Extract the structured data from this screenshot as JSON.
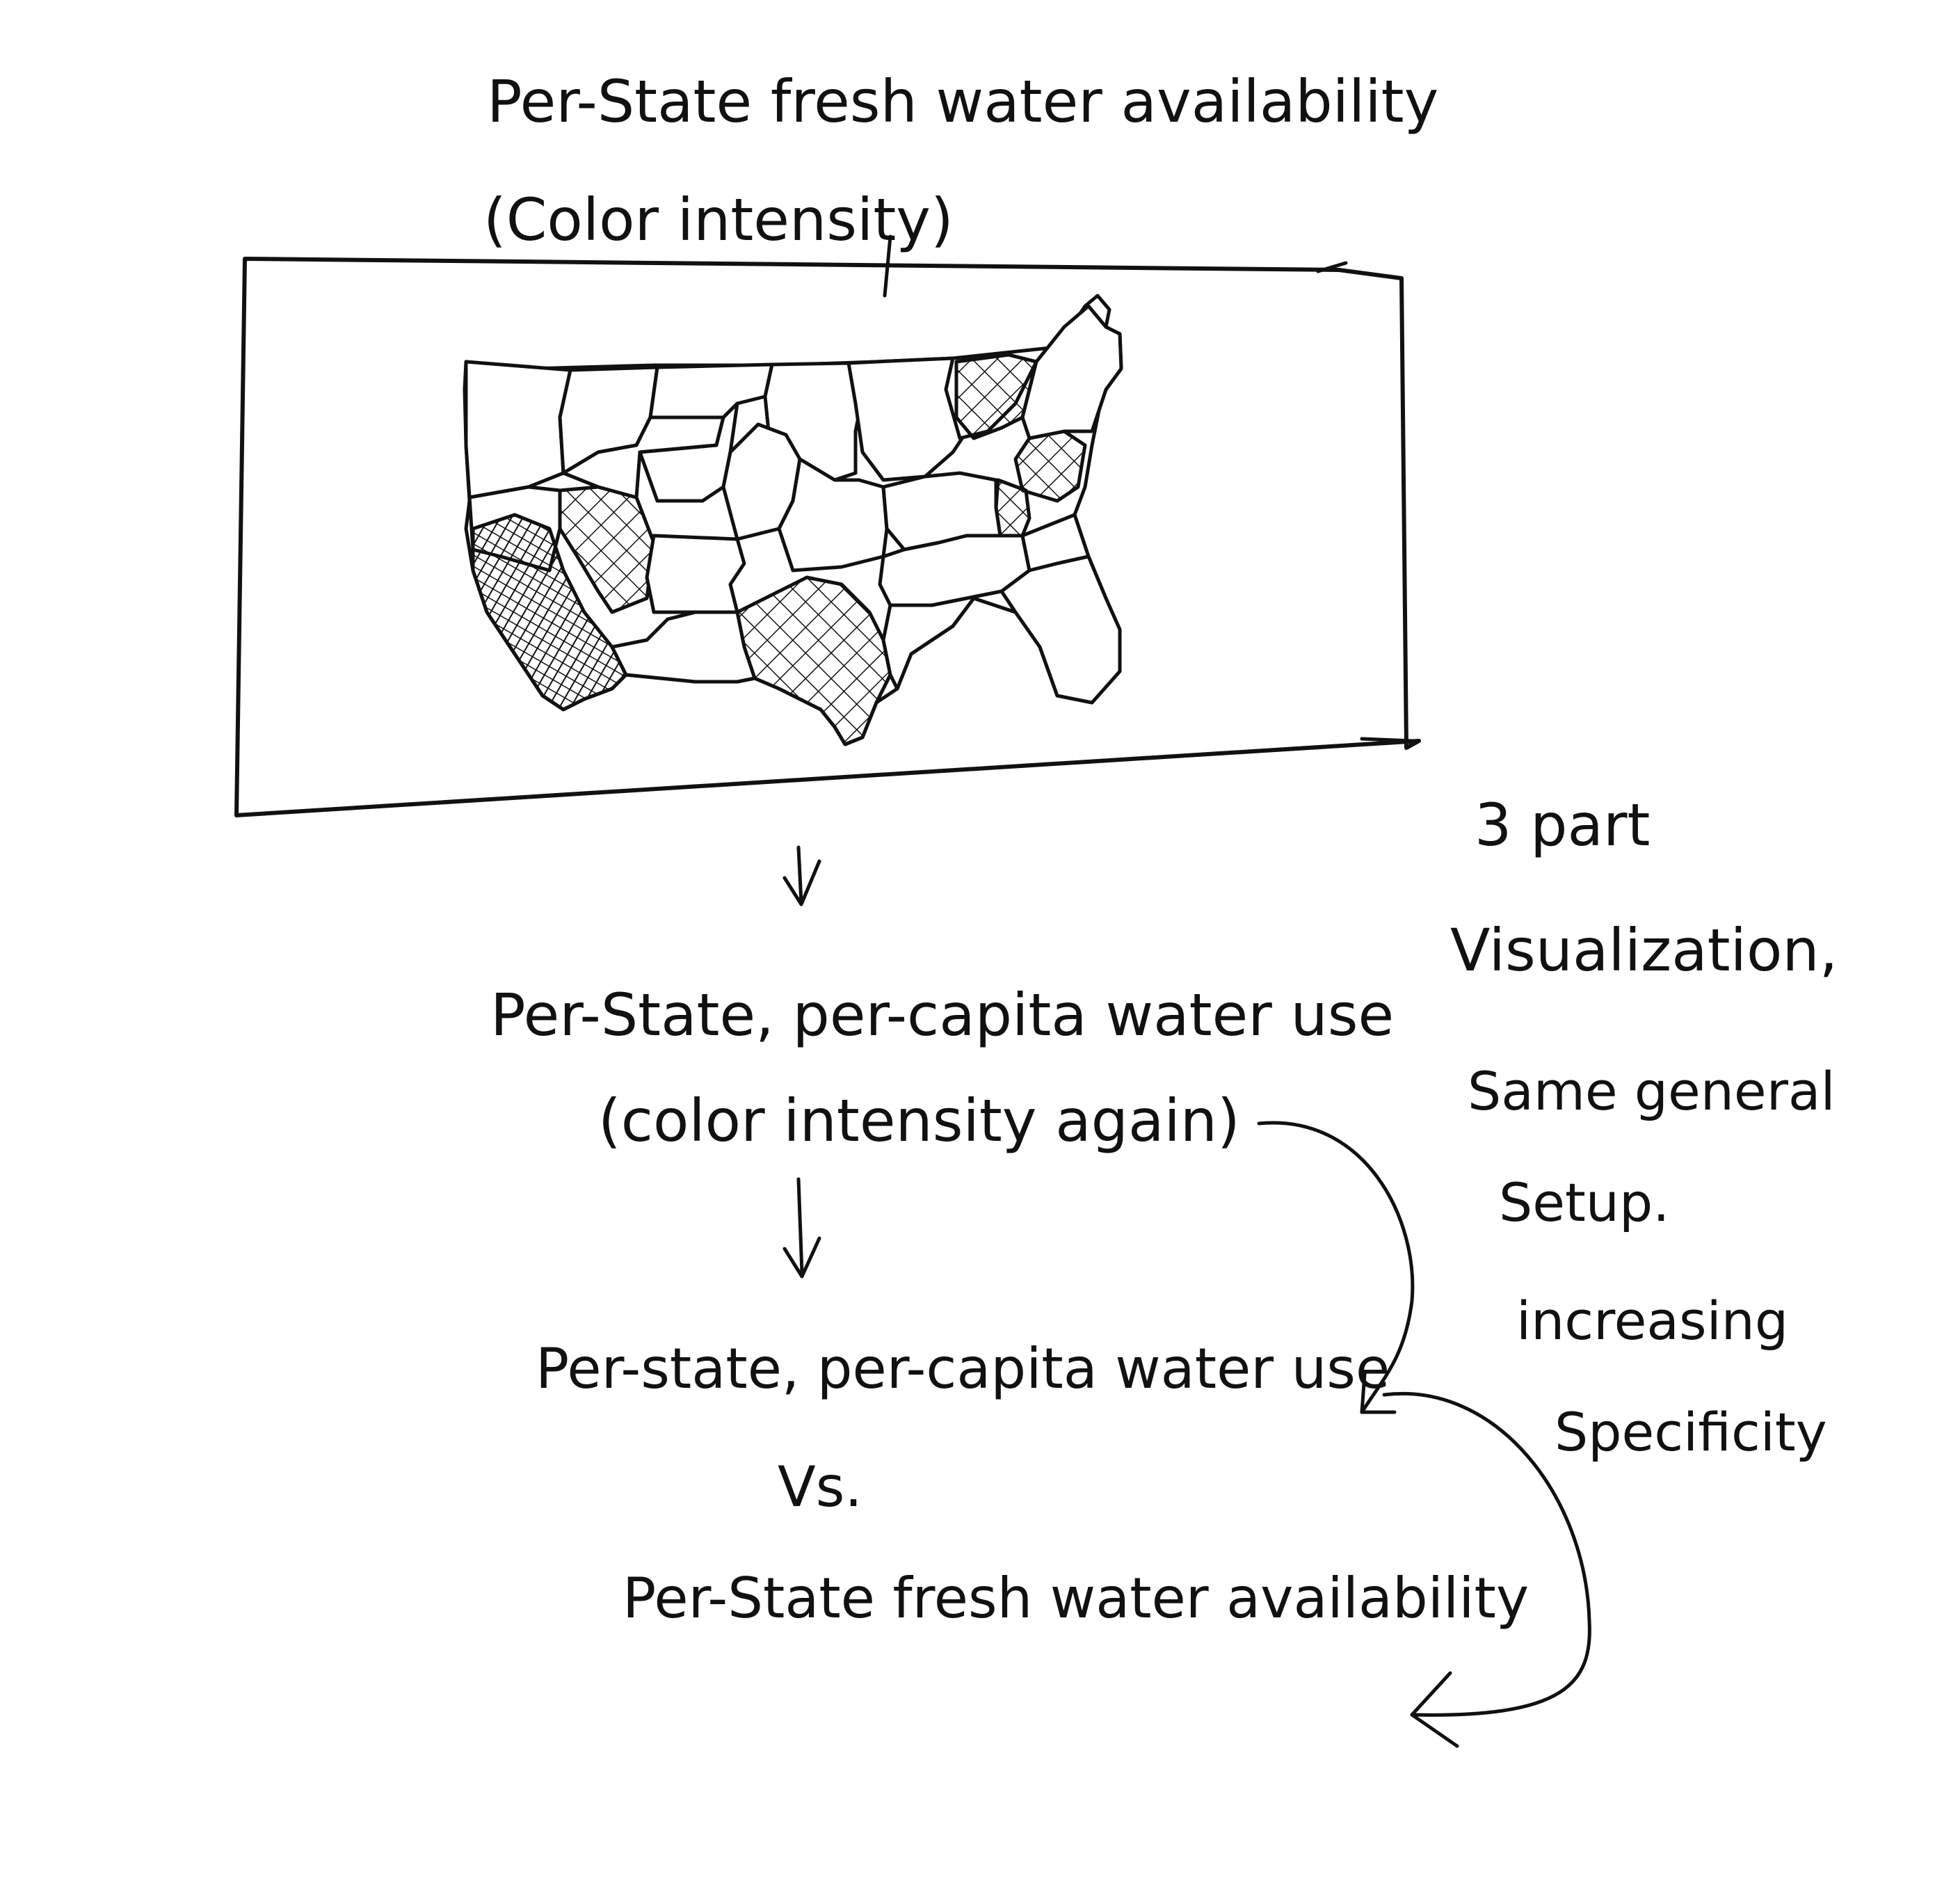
{
  "title": {
    "line1": "Per-State fresh water availability",
    "line2": "(Color intensity)"
  },
  "step2": {
    "line1": "Per-State, per-capita water use",
    "line2": "(color intensity again)"
  },
  "step3": {
    "line1": "Per-state, per-capita water use",
    "vs": "Vs.",
    "line2": "Per-State fresh water availability"
  },
  "side_note": {
    "lines": [
      "3 part",
      "Visualization,",
      "Same general",
      "Setup.",
      "increasing",
      "Specificity"
    ]
  },
  "map": {
    "subject": "continental-us-map",
    "encoding": "color intensity (shown as hatching)"
  },
  "colors": {
    "ink": "#111111",
    "paper": "#ffffff"
  }
}
